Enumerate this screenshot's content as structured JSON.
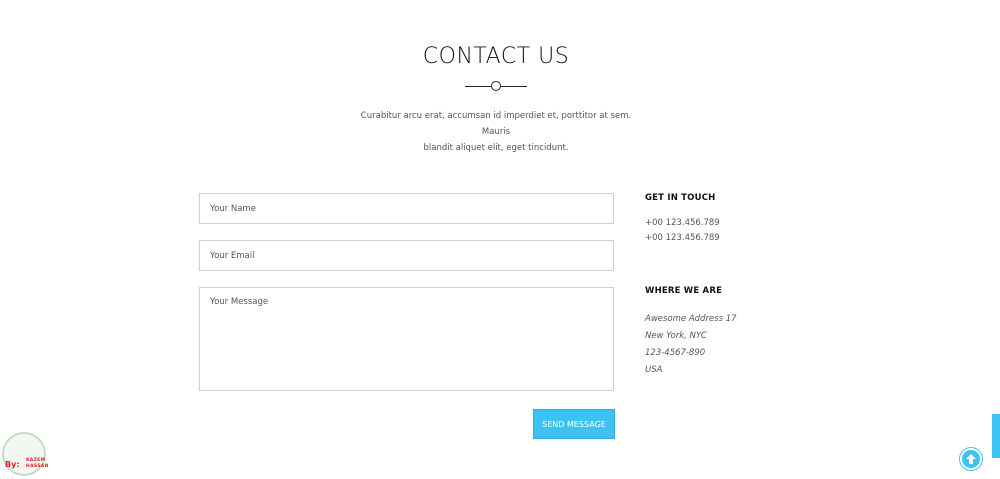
{
  "header": {
    "title": "CONTACT US",
    "intro_line1": "Curabitur arcu erat, accumsan id imperdiet et, porttitor at sem. Mauris",
    "intro_line2": "blandit aliquet elit, eget tincidunt."
  },
  "form": {
    "name_placeholder": "Your Name",
    "email_placeholder": "Your Email",
    "message_placeholder": "Your Message",
    "submit_label": "SEND MESSAGE"
  },
  "contact": {
    "get_in_touch_heading": "GET IN TOUCH",
    "phones": [
      "+00 123.456.789",
      "+00 123.456.789"
    ],
    "where_heading": "WHERE WE ARE",
    "address": [
      "Awesome Address 17",
      "New York, NYC",
      "123-4567-890",
      "USA"
    ]
  },
  "watermark": {
    "by": "By:",
    "name_line1": "KAZEM",
    "name_line2": "HASSAN"
  },
  "colors": {
    "accent": "#3cc3f3",
    "text": "#555555",
    "heading": "#111111",
    "border": "#cfcfcf"
  },
  "icons": {
    "scroll_top": "arrow-up-circle-icon"
  }
}
